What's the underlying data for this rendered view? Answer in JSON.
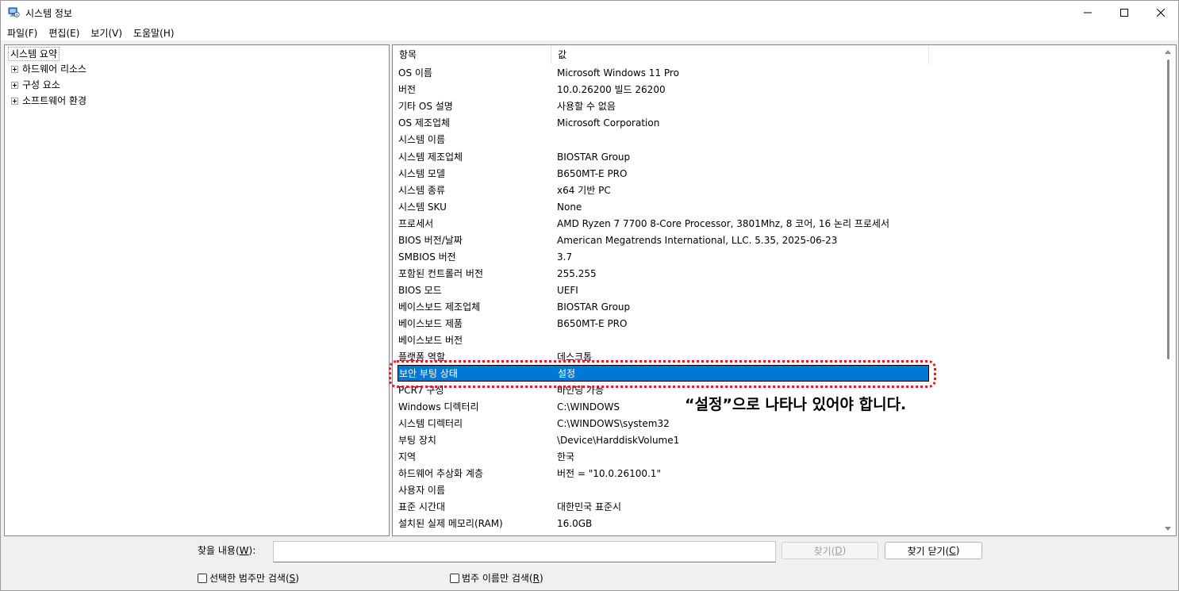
{
  "window": {
    "title": "시스템 정보",
    "min_symbol": "—",
    "max_symbol": "☐",
    "close_symbol": "✕"
  },
  "menu": [
    {
      "label": "파일(F)"
    },
    {
      "label": "편집(E)"
    },
    {
      "label": "보기(V)"
    },
    {
      "label": "도움말(H)"
    }
  ],
  "tree": {
    "root": "시스템 요약",
    "nodes": [
      {
        "label": "하드웨어 리소스"
      },
      {
        "label": "구성 요소"
      },
      {
        "label": "소프트웨어 환경"
      }
    ]
  },
  "list": {
    "header_item": "항목",
    "header_value": "값",
    "rows": [
      {
        "item": "OS 이름",
        "value": "Microsoft Windows 11 Pro"
      },
      {
        "item": "버전",
        "value": "10.0.26200 빌드 26200"
      },
      {
        "item": "기타 OS 설명",
        "value": "사용할 수 없음"
      },
      {
        "item": "OS 제조업체",
        "value": "Microsoft Corporation"
      },
      {
        "item": "시스템 이름",
        "value": ""
      },
      {
        "item": "시스템 제조업체",
        "value": "BIOSTAR Group"
      },
      {
        "item": "시스템 모델",
        "value": "B650MT-E PRO"
      },
      {
        "item": "시스템 종류",
        "value": "x64 기반 PC"
      },
      {
        "item": "시스템 SKU",
        "value": "None"
      },
      {
        "item": "프로세서",
        "value": "AMD Ryzen 7 7700 8-Core Processor, 3801Mhz, 8 코어, 16 논리 프로세서"
      },
      {
        "item": "BIOS 버전/날짜",
        "value": "American Megatrends International, LLC. 5.35, 2025-06-23"
      },
      {
        "item": "SMBIOS 버전",
        "value": "3.7"
      },
      {
        "item": "포함된 컨트롤러 버전",
        "value": "255.255"
      },
      {
        "item": "BIOS 모드",
        "value": "UEFI"
      },
      {
        "item": "베이스보드 제조업체",
        "value": "BIOSTAR Group"
      },
      {
        "item": "베이스보드 제품",
        "value": "B650MT-E PRO"
      },
      {
        "item": "베이스보드 버전",
        "value": ""
      },
      {
        "item": "플랫폼 역할",
        "value": "데스크톱"
      },
      {
        "item": "보안 부팅 상태",
        "value": "설정",
        "selected": true
      },
      {
        "item": "PCR7 구성",
        "value": "바인딩 가능"
      },
      {
        "item": "Windows 디렉터리",
        "value": "C:\\WINDOWS"
      },
      {
        "item": "시스템 디렉터리",
        "value": "C:\\WINDOWS\\system32"
      },
      {
        "item": "부팅 장치",
        "value": "\\Device\\HarddiskVolume1"
      },
      {
        "item": "지역",
        "value": "한국"
      },
      {
        "item": "하드웨어 추상화 계층",
        "value": "버전 = \"10.0.26100.1\""
      },
      {
        "item": "사용자 이름",
        "value": ""
      },
      {
        "item": "표준 시간대",
        "value": "대한민국 표준시"
      },
      {
        "item": "설치된 실제 메모리(RAM)",
        "value": "16.0GB"
      }
    ]
  },
  "annotation": {
    "text": "“설정”으로 나타나 있어야 합니다.",
    "color": "#e0201e"
  },
  "find": {
    "label_pre": "찾을 내용(",
    "label_key": "W",
    "label_post": "):",
    "input_value": "",
    "find_btn_pre": "찾기(",
    "find_btn_key": "D",
    "find_btn_post": ")",
    "close_btn_pre": "찾기 닫기(",
    "close_btn_key": "C",
    "close_btn_post": ")",
    "chk_selected_pre": "선택한 범주만 검색(",
    "chk_selected_key": "S",
    "chk_selected_post": ")",
    "chk_names_pre": "범주 이름만 검색(",
    "chk_names_key": "R",
    "chk_names_post": ")"
  },
  "colors": {
    "selection": "#0078d7",
    "accent": "#0078d7"
  }
}
